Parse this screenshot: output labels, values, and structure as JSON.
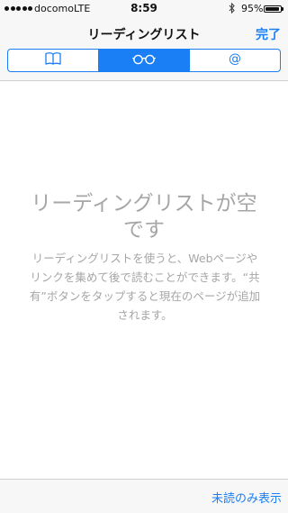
{
  "status_bar": {
    "carrier": "docomo",
    "network": "LTE",
    "time": "8:59",
    "battery_percent": "95%",
    "battery_level": 0.95
  },
  "nav": {
    "title": "リーディングリスト",
    "done_label": "完了"
  },
  "segments": [
    {
      "icon": "book-icon",
      "selected": false
    },
    {
      "icon": "glasses-icon",
      "selected": true
    },
    {
      "icon": "at-icon",
      "selected": false
    }
  ],
  "empty_state": {
    "title": "リーディングリストが空です",
    "description": "リーディングリストを使うと、Webページやリンクを集めて後で読むことができます。“共有”ボタンをタップすると現在のページが追加されます。"
  },
  "toolbar": {
    "show_unread_label": "未読のみ表示"
  },
  "colors": {
    "accent": "#1a7ff5",
    "placeholder_text": "#a6a6a6",
    "bar_background": "#f7f7f7"
  }
}
